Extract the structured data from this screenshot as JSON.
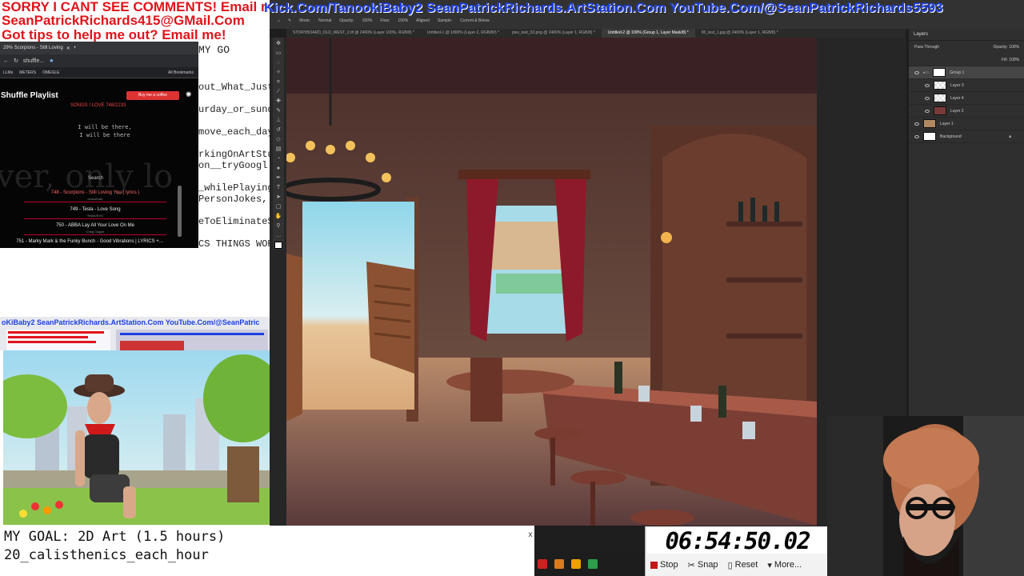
{
  "overlay": {
    "line1": "SORRY I CANT SEE COMMENTS! Email me:",
    "line2": "SeanPatrickRichards415@GMail.Com",
    "line3": "Got tips to help me out? Email me!",
    "header_banner": "Kick.Com/TanookiBaby2 SeanPatrickRichards.ArtStation.Com YouTube.Com/@SeanPatrickRichards5593",
    "cam_banner": "oKiBaby2 SeanPatrickRichards.ArtStation.Com YouTube.Com/@SeanPatric"
  },
  "notepad": {
    "lines": [
      "MY GO",
      "out_What_Just_",
      "urday_or_sunday",
      "move_each_day_",
      "rkingOnArtStuf",
      "on__tryGoogl",
      "_whilePlayingP",
      "PersonJokes,",
      "eToEliminateS",
      "CS THINGS WOR"
    ]
  },
  "browser": {
    "tab_title": "29% Scorpions - Still Loving",
    "address": "shuffle...",
    "bookmarks": [
      "LLMs",
      "METERS",
      "OMEGLE",
      "All Bookmarks"
    ]
  },
  "playlist": {
    "title": "Shuffle Playlist",
    "coffee_button": "Buy me a coffee",
    "songs_label": "SONGS I LOVE   748/2233",
    "lyric": "I will be there, I will be there",
    "ghost": "ver, only lo",
    "search_label": "Search",
    "songs": [
      {
        "title": "748 - Scorpions - Still Loving You ( lyrics )",
        "channel": "chocohoiic",
        "color": "#ff6666"
      },
      {
        "title": "749 - Tesla - Love Song",
        "channel": "TeslaVEVO",
        "color": "#eeeeee"
      },
      {
        "title": "750 - ABBA Lay All Your Love On Me",
        "channel": "Craig Gagne",
        "color": "#eeeeee"
      },
      {
        "title": "751 - Marky Mark & the Funky Bunch - Good Vibrations | LYRICS +...",
        "channel": "",
        "color": "#eeeeee"
      }
    ]
  },
  "photoshop": {
    "options": [
      "Mode:",
      "Normal",
      "Opacity:",
      "100%",
      "Flow:",
      "100%",
      "Aligned",
      "Sample:",
      "Current & Below"
    ],
    "tabs": [
      {
        "label": "STORYBOARD_OLD_WEST_2.tif @ 2400% (Layer 100%, RGB/8) *",
        "active": false
      },
      {
        "label": "Untitled-1 @ 1800% (Layer 2, RGB/8#) *",
        "active": false
      },
      {
        "label": "piss_test_02.png @ 2400% (Layer 1, RGB/8) *",
        "active": false
      },
      {
        "label": "Untitled-2 @ 100% (Group 1, Layer Mask/8) *",
        "active": true
      },
      {
        "label": "00_test_1.jpg @ 2400% (Layer 1, RGB/8) *",
        "active": false
      }
    ],
    "layers_panel_title": "Layers",
    "blend": "Pass Through",
    "opacity": "Opacity: 100%",
    "fill": "Fill: 100%",
    "layers": [
      "Group 1",
      "Layer 3",
      "Layer 4",
      "Layer 2",
      "Layer 1",
      "Background"
    ]
  },
  "goal": {
    "line1": "MY GOAL: 2D Art (1.5 hours)",
    "line2": "20_calisthenics_each_hour",
    "close": "x"
  },
  "timer": {
    "value": "06:54:50.02",
    "stop": "Stop",
    "snap": "Snap",
    "reset": "Reset",
    "more": "More..."
  }
}
